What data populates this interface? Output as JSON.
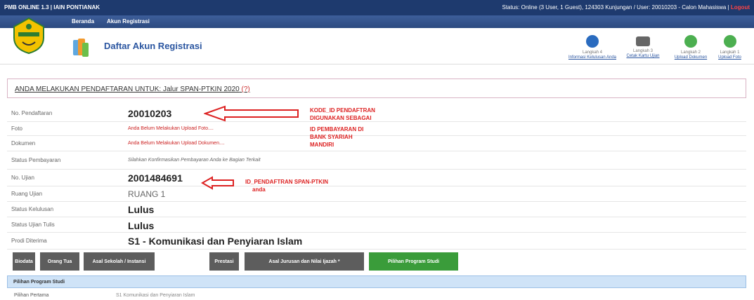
{
  "topbar": {
    "system_title": "PMB ONLINE 1.3 | IAIN PONTIANAK",
    "status_text": "Status: Online (3 User, 1 Guest), 124303 Kunjungan / User: 20010203 - Calon Mahasiswa |",
    "logout_label": "Logout"
  },
  "navbar": {
    "items": [
      "Beranda",
      "Akun Registrasi"
    ]
  },
  "header": {
    "title": "Daftar Akun Registrasi"
  },
  "steps": [
    {
      "label": "Langkah 4",
      "sub": "Informasi Kelulusan Anda",
      "color": "#2a6bbf"
    },
    {
      "label": "Langkah 3",
      "sub": "Cetak Kartu Ujian",
      "color": "#666666"
    },
    {
      "label": "Langkah 2",
      "sub": "Upload Dokumen",
      "color": "#4caf50"
    },
    {
      "label": "Langkah 1",
      "sub": "Upload Foto",
      "color": "#4caf50"
    }
  ],
  "notice": {
    "text": "ANDA MELAKUKAN PENDAFTARAN UNTUK: Jalur SPAN-PTKIN 2020",
    "help": "(?)"
  },
  "rows": [
    {
      "label": "No. Pendaftaran",
      "value": "20010203"
    },
    {
      "label": "Foto",
      "value": "Anda Belum Melakukan Upload Foto...."
    },
    {
      "label": "Dokumen",
      "value": "Anda Belum Melakukan Upload Dokumen...."
    },
    {
      "label": "Status Pembayaran",
      "value": "Silahkan Konfirmasikan Pembayaran Anda ke Bagian Terkait"
    },
    {
      "label": "No. Ujian",
      "value": "2001484691"
    },
    {
      "label": "Ruang Ujian",
      "value": "RUANG 1"
    },
    {
      "label": "Status Kelulusan",
      "value": "Lulus"
    },
    {
      "label": "Status Ujian Tulis",
      "value": "Lulus"
    },
    {
      "label": "Prodi Diterima",
      "value": "S1 - Komunikasi dan Penyiaran Islam"
    }
  ],
  "annotations": {
    "kode_lines": [
      "KODE_ID PENDAFTRAN",
      "DIGUNAKAN SEBAGAI",
      "ID PEMBAYARAN DI",
      "BANK SYARIAH",
      "MANDIRI"
    ],
    "id_lines": [
      "ID_PENDAFTRAN SPAN-PTKIN",
      "anda"
    ],
    "color": "#dd2222"
  },
  "tabs": [
    "Biodata",
    "Orang Tua",
    "Asal Sekolah / Instansi",
    "Prestasi",
    "Asal Jurusan dan Nilai Ijazah *",
    "Pilihan Program Studi"
  ],
  "panel": {
    "title": "Pilihan Program Studi",
    "row_label": "Pilihan Pertama",
    "row_value": "S1 Komunikasi dan Penyiaran Islam"
  }
}
